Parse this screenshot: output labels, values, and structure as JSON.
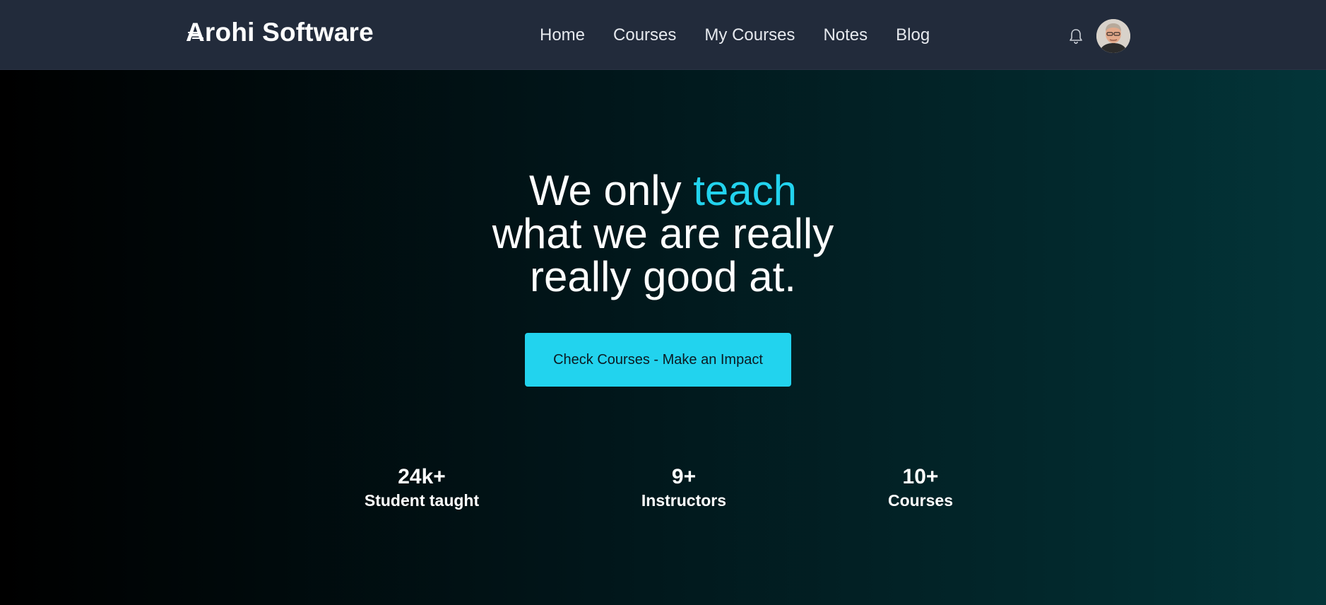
{
  "brand": {
    "name": "Arohi Software"
  },
  "nav": {
    "items": [
      {
        "label": "Home"
      },
      {
        "label": "Courses"
      },
      {
        "label": "My Courses"
      },
      {
        "label": "Notes"
      },
      {
        "label": "Blog"
      }
    ]
  },
  "header_actions": {
    "notification_icon": "bell-icon",
    "avatar_icon": "user-avatar"
  },
  "hero": {
    "headline_line1_prefix": "We only ",
    "headline_line1_accent": "teach",
    "headline_line2": "what we are really",
    "headline_line3": "really good at.",
    "cta_label": "Check Courses - Make an Impact"
  },
  "stats": [
    {
      "value": "24k+",
      "label": "Student taught"
    },
    {
      "value": "9+",
      "label": "Instructors"
    },
    {
      "value": "10+",
      "label": "Courses"
    }
  ],
  "colors": {
    "accent": "#22d3ee",
    "navbar": "#222b3b",
    "background_start": "#000000",
    "background_end": "#033539"
  }
}
